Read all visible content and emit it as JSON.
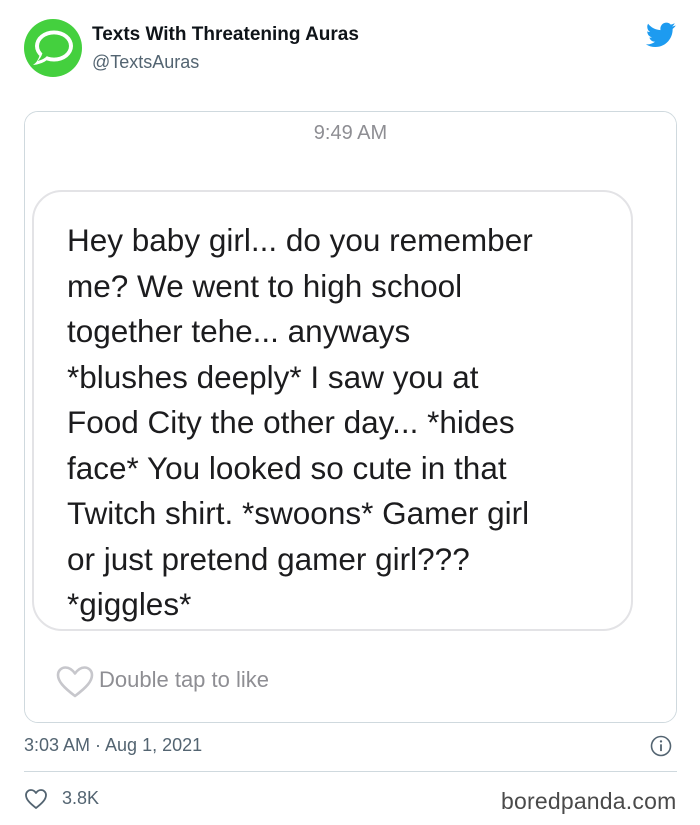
{
  "tweet": {
    "author": {
      "display_name": "Texts With Threatening Auras",
      "handle": "@TextsAuras",
      "avatar_icon": "message-bubble-icon",
      "avatar_color": "#44d03e"
    },
    "platform_icon": "twitter-bird-icon",
    "brand_color": "#1d9bf0",
    "screenshot": {
      "time": "9:49 AM",
      "message": "Hey baby girl... do you remember\nme? We went to high school\ntogether tehe... anyways\n*blushes deeply* I saw you at\nFood City the other day... *hides\nface* You looked so cute in that\nTwitch shirt. *swoons* Gamer girl\nor just pretend gamer girl???\n*giggles*",
      "like_hint": "Double tap to like"
    },
    "timestamp": "3:03 AM · Aug 1, 2021",
    "like_count": "3.8K"
  },
  "watermark": "boredpanda.com"
}
